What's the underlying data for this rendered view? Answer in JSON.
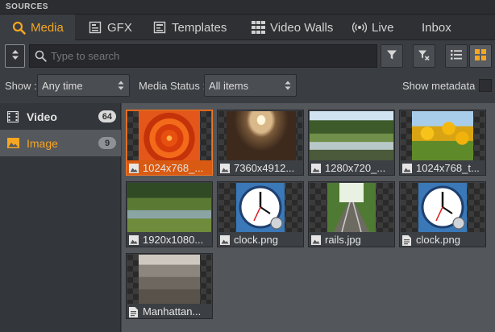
{
  "panel": {
    "title": "SOURCES"
  },
  "tabs": [
    {
      "label": "Media",
      "icon": "search-icon",
      "active": true
    },
    {
      "label": "GFX",
      "icon": "gfx-icon"
    },
    {
      "label": "Templates",
      "icon": "template-icon"
    },
    {
      "label": "Video Walls",
      "icon": "grid-icon"
    },
    {
      "label": "Live",
      "icon": "broadcast-icon"
    },
    {
      "label": "Inbox",
      "icon": ""
    }
  ],
  "search": {
    "placeholder": "Type to search",
    "value": ""
  },
  "filters": {
    "show_label": "Show :",
    "show_value": "Any time",
    "status_label": "Media Status :",
    "status_value": "All items",
    "metadata_label": "Show metadata :"
  },
  "sidebar": {
    "items": [
      {
        "label": "Video",
        "count": "64",
        "icon": "film-icon"
      },
      {
        "label": "Image",
        "count": "9",
        "icon": "image-icon",
        "active": true
      }
    ]
  },
  "media": [
    {
      "name": "1024x768_...",
      "kind": "image",
      "selected": true
    },
    {
      "name": "7360x4912...",
      "kind": "image"
    },
    {
      "name": "1280x720_...",
      "kind": "image"
    },
    {
      "name": "1024x768_t...",
      "kind": "image"
    },
    {
      "name": "1920x1080...",
      "kind": "image"
    },
    {
      "name": "clock.png",
      "kind": "image"
    },
    {
      "name": "rails.jpg",
      "kind": "image"
    },
    {
      "name": "clock.png",
      "kind": "document"
    },
    {
      "name": "Manhattan...",
      "kind": "document"
    }
  ],
  "colors": {
    "accent": "#f5a623",
    "selected": "#d95a12"
  }
}
